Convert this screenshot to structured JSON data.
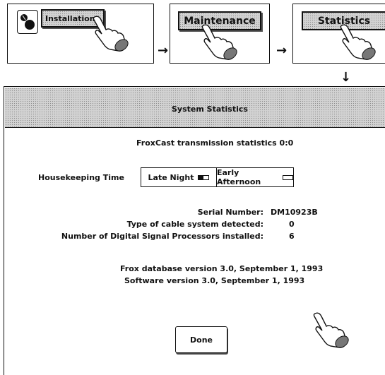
{
  "flow": {
    "installation_label": "Installation",
    "maintenance_label": "Maintenance",
    "statistics_label": "Statistics",
    "arrow_right": "→",
    "arrow_down": "↓"
  },
  "window": {
    "title": "System Statistics"
  },
  "content": {
    "transmission_line": "FroxCast transmission statistics  0:0",
    "housekeeping_label": "Housekeeping Time",
    "options": [
      "Late Night",
      "Early Afternoon"
    ],
    "serial_label": "Serial Number:",
    "serial_value": "DM10923B",
    "cable_label": "Type of cable system detected:",
    "cable_value": "0",
    "dsp_label": "Number of Digital Signal Processors installed:",
    "dsp_value": "6",
    "db_version": "Frox database version 3.0, September 1, 1993",
    "sw_version": "Software version 3.0, September 1, 1993",
    "done_label": "Done"
  },
  "icons": [
    "pushpin-icon",
    "hand-pointer-icon",
    "arrow-right-icon",
    "arrow-down-icon"
  ]
}
